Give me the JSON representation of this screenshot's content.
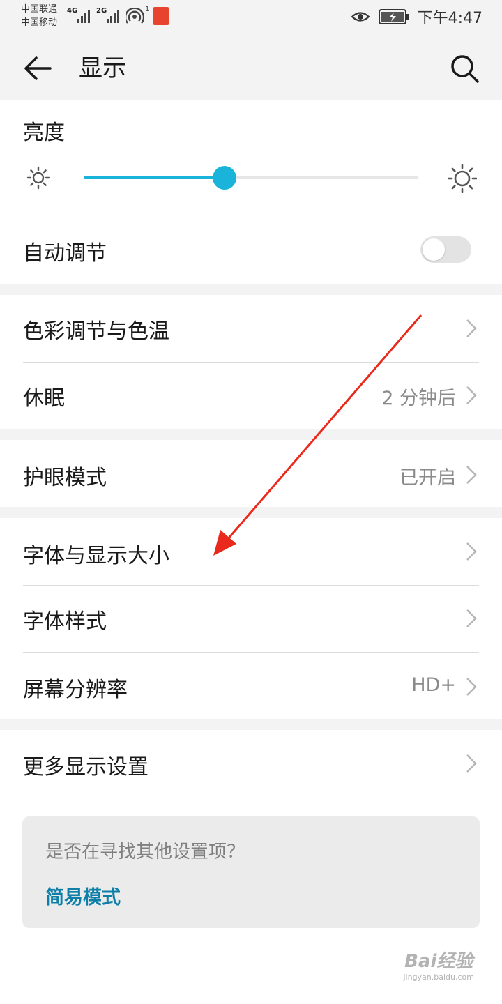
{
  "status_bar": {
    "carrier_1": "中国联通",
    "carrier_2": "中国移动",
    "network_1": "4G",
    "network_2": "2G",
    "hotspot_count": "1",
    "time": "下午4:47"
  },
  "header": {
    "title": "显示"
  },
  "brightness": {
    "label": "亮度",
    "level_fraction": 0.42
  },
  "auto_adjust": {
    "label": "自动调节",
    "enabled": false
  },
  "items": {
    "color": {
      "label": "色彩调节与色温"
    },
    "sleep": {
      "label": "休眠",
      "value": "2 分钟后"
    },
    "eye_comfort": {
      "label": "护眼模式",
      "value": "已开启"
    },
    "font_size": {
      "label": "字体与显示大小"
    },
    "font_style": {
      "label": "字体样式"
    },
    "resolution": {
      "label": "屏幕分辨率",
      "value": "HD+"
    },
    "more": {
      "label": "更多显示设置"
    }
  },
  "hint": {
    "question": "是否在寻找其他设置项？",
    "link": "简易模式"
  },
  "watermark": {
    "logo": "Bai经验",
    "url": "jingyan.baidu.com"
  },
  "colors": {
    "accent": "#1ab4db",
    "annotation": "#e8291c",
    "link": "#0d7fa8"
  }
}
